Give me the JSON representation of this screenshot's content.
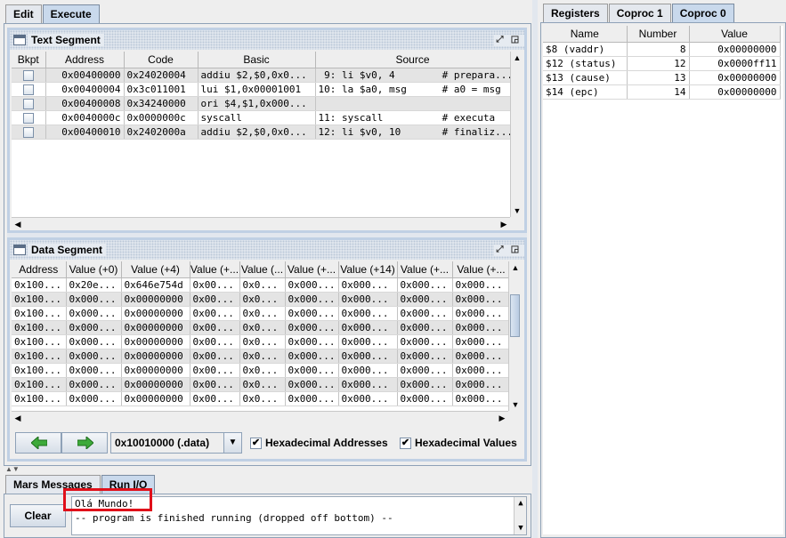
{
  "left_tabs": [
    {
      "label": "Edit",
      "selected": false
    },
    {
      "label": "Execute",
      "selected": true
    }
  ],
  "text_segment": {
    "title": "Text Segment",
    "columns": [
      "Bkpt",
      "Address",
      "Code",
      "Basic",
      "Source"
    ],
    "rows": [
      {
        "address": "0x00400000",
        "code": "0x24020004",
        "basic": "addiu $2,$0,0x0...",
        "source": " 9: li $v0, 4        # prepara..."
      },
      {
        "address": "0x00400004",
        "code": "0x3c011001",
        "basic": "lui $1,0x00001001",
        "source": "10: la $a0, msg      # a0 = msg"
      },
      {
        "address": "0x00400008",
        "code": "0x34240000",
        "basic": "ori $4,$1,0x000...",
        "source": ""
      },
      {
        "address": "0x0040000c",
        "code": "0x0000000c",
        "basic": "syscall",
        "source": "11: syscall          # executa"
      },
      {
        "address": "0x00400010",
        "code": "0x2402000a",
        "basic": "addiu $2,$0,0x0...",
        "source": "12: li $v0, 10       # finaliz..."
      }
    ]
  },
  "data_segment": {
    "title": "Data Segment",
    "columns": [
      "Address",
      "Value (+0)",
      "Value (+4)",
      "Value (+...",
      "Value (...",
      "Value (+...",
      "Value (+14)",
      "Value (+...",
      "Value (+..."
    ],
    "rows": [
      [
        "0x100...",
        "0x20e...",
        "0x646e754d",
        "0x00...",
        "0x0...",
        "0x000...",
        "0x000...",
        "0x000...",
        "0x000..."
      ],
      [
        "0x100...",
        "0x000...",
        "0x00000000",
        "0x00...",
        "0x0...",
        "0x000...",
        "0x000...",
        "0x000...",
        "0x000..."
      ],
      [
        "0x100...",
        "0x000...",
        "0x00000000",
        "0x00...",
        "0x0...",
        "0x000...",
        "0x000...",
        "0x000...",
        "0x000..."
      ],
      [
        "0x100...",
        "0x000...",
        "0x00000000",
        "0x00...",
        "0x0...",
        "0x000...",
        "0x000...",
        "0x000...",
        "0x000..."
      ],
      [
        "0x100...",
        "0x000...",
        "0x00000000",
        "0x00...",
        "0x0...",
        "0x000...",
        "0x000...",
        "0x000...",
        "0x000..."
      ],
      [
        "0x100...",
        "0x000...",
        "0x00000000",
        "0x00...",
        "0x0...",
        "0x000...",
        "0x000...",
        "0x000...",
        "0x000..."
      ],
      [
        "0x100...",
        "0x000...",
        "0x00000000",
        "0x00...",
        "0x0...",
        "0x000...",
        "0x000...",
        "0x000...",
        "0x000..."
      ],
      [
        "0x100...",
        "0x000...",
        "0x00000000",
        "0x00...",
        "0x0...",
        "0x000...",
        "0x000...",
        "0x000...",
        "0x000..."
      ],
      [
        "0x100...",
        "0x000...",
        "0x00000000",
        "0x00...",
        "0x0...",
        "0x000...",
        "0x000...",
        "0x000...",
        "0x000..."
      ]
    ],
    "segment_select": "0x10010000 (.data)",
    "hex_addresses_label": "Hexadecimal Addresses",
    "hex_addresses_checked": true,
    "hex_values_label": "Hexadecimal Values",
    "hex_values_checked": true
  },
  "bottom_tabs": [
    {
      "label": "Mars Messages",
      "selected": false
    },
    {
      "label": "Run I/O",
      "selected": true
    }
  ],
  "run_io": {
    "clear_label": "Clear",
    "lines": [
      "Olá Mundo!",
      "-- program is finished running (dropped off bottom) --"
    ]
  },
  "right_tabs": [
    {
      "label": "Registers",
      "selected": false
    },
    {
      "label": "Coproc 1",
      "selected": false
    },
    {
      "label": "Coproc 0",
      "selected": true
    }
  ],
  "coproc0": {
    "columns": [
      "Name",
      "Number",
      "Value"
    ],
    "rows": [
      {
        "name": "$8 (vaddr)",
        "number": "8",
        "value": "0x00000000"
      },
      {
        "name": "$12 (status)",
        "number": "12",
        "value": "0x0000ff11"
      },
      {
        "name": "$13 (cause)",
        "number": "13",
        "value": "0x00000000"
      },
      {
        "name": "$14 (epc)",
        "number": "14",
        "value": "0x00000000"
      }
    ]
  },
  "colors": {
    "highlight_border": "#e0101a",
    "accent_tab": "#c9d9ec"
  }
}
